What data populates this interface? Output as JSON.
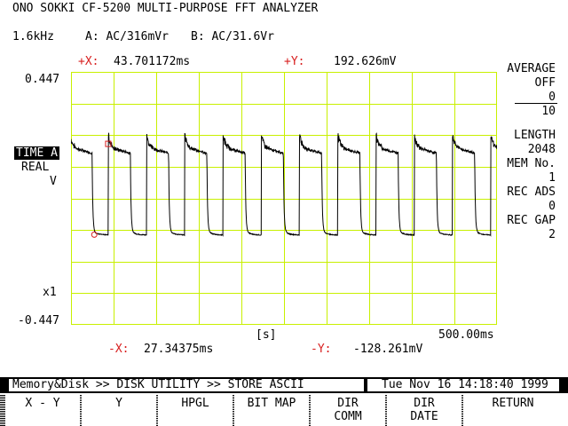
{
  "header": {
    "title": "ONO SOKKI CF-5200 MULTI-PURPOSE FFT ANALYZER",
    "freq_range": "1.6kHz",
    "channel_a": "A: AC/316mVr",
    "channel_b": "B: AC/31.6Vr"
  },
  "cursor": {
    "plus_x_label": "+X:",
    "plus_x_value": "43.701172ms",
    "plus_y_label": "+Y:",
    "plus_y_value": "192.626mV",
    "minus_x_label": "-X:",
    "minus_x_value": "27.34375ms",
    "minus_y_label": "-Y:",
    "minus_y_value": "-128.261mV"
  },
  "axis": {
    "y_top": "0.447",
    "y_bottom": "-0.447",
    "scale": "x1",
    "x_unit": "[s]",
    "x_end": "500.00ms"
  },
  "trace_labels": {
    "mode": "TIME A",
    "type": "REAL",
    "unit": "V"
  },
  "right_panel": {
    "average_label": "AVERAGE",
    "average_state": "OFF",
    "average_count": "0",
    "average_total": "10",
    "length_label": "LENGTH",
    "length_value": "2048",
    "mem_label": "MEM No.",
    "mem_value": "1",
    "rec_ads_label": "REC ADS",
    "rec_ads_value": "0",
    "rec_gap_label": "REC GAP",
    "rec_gap_value": "2"
  },
  "status_bar": {
    "path": "Memory&Disk >> DISK UTILITY >> STORE ASCII",
    "datetime": "Tue Nov 16 14:18:40 1999"
  },
  "function_keys": [
    {
      "line1": "X - Y",
      "line2": ""
    },
    {
      "line1": "Y",
      "line2": ""
    },
    {
      "line1": "HPGL",
      "line2": ""
    },
    {
      "line1": "BIT MAP",
      "line2": ""
    },
    {
      "line1": "DIR",
      "line2": "COMM"
    },
    {
      "line1": "DIR",
      "line2": "DATE"
    },
    {
      "line1": "RETURN",
      "line2": ""
    }
  ],
  "chart_data": {
    "type": "line",
    "xlim": [
      0,
      500
    ],
    "ylim": [
      -0.447,
      0.447
    ],
    "grid": true,
    "series": [
      {
        "color": "#000000",
        "waveform": "square",
        "period_ms": 44.9,
        "first_rising_edge_ms": 43.7,
        "falling_edge_ms": 19.0,
        "high_v": 0.18,
        "low_v": -0.13
      }
    ],
    "cursor_plus": {
      "x": 43.701172,
      "y": 0.192626
    },
    "cursor_minus": {
      "x": 27.34375,
      "y": -0.128261
    }
  }
}
